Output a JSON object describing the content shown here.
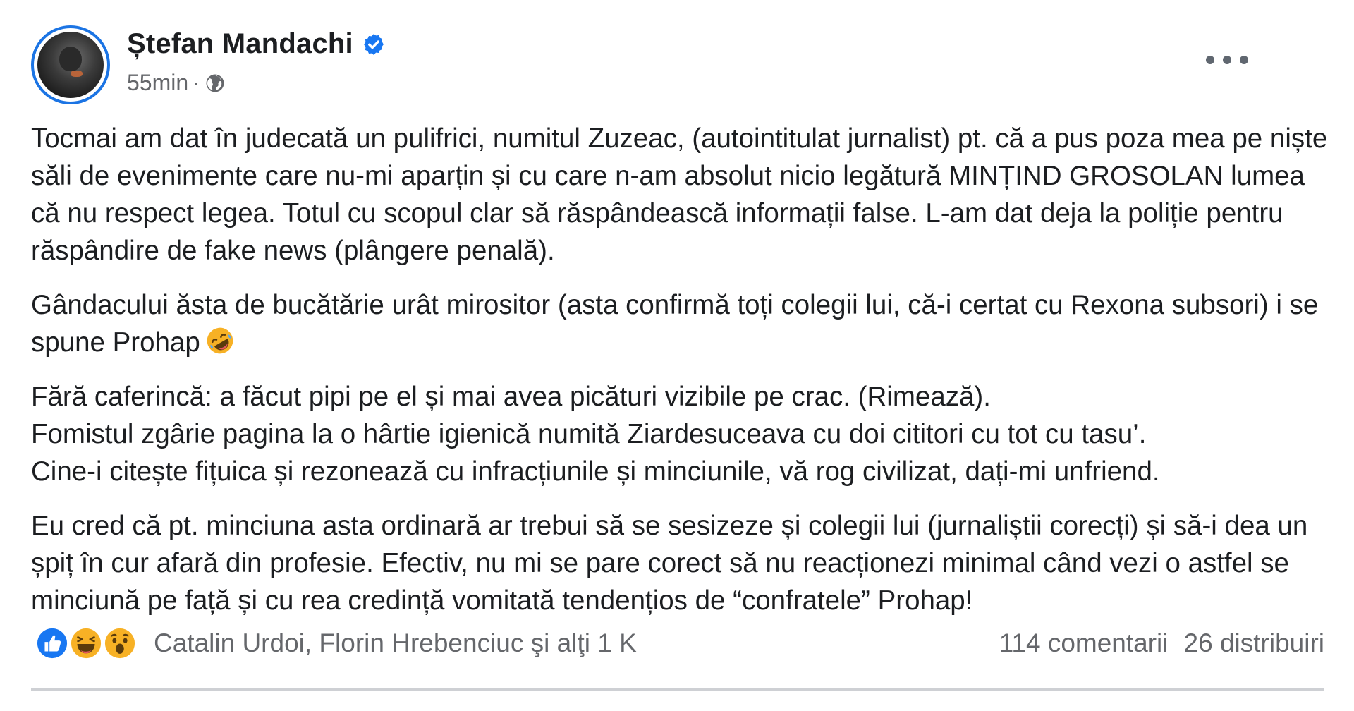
{
  "post": {
    "author": "Ștefan Mandachi",
    "timestamp": "55min",
    "separator": "·",
    "paragraphs": [
      [
        "Tocmai am dat în judecată un pulifrici, numitul Zuzeac, (autointitulat jurnalist) pt. că a pus poza mea pe niște săli de evenimente care nu-mi aparțin și cu care n-am absolut nicio legătură MINȚIND GROSOLAN lumea că nu respect legea. Totul cu scopul clar să răspândească informații false. L-am dat deja la poliție pentru răspândire de fake news (plângere penală)."
      ],
      [
        "Gândacului ăsta de bucătărie urât mirositor (asta confirmă toți colegii lui, că-i certat cu Rexona subsori) i se spune Prohap"
      ],
      [
        "Fără caferincă: a făcut pipi pe el și mai avea picături vizibile pe crac. (Rimează).",
        "Fomistul zgârie pagina la o hârtie igienică numită Ziardesuceava cu doi cititori cu tot cu tasu’.",
        "Cine-i citește fițuica și rezonează cu infracțiunile și minciunile, vă rog civilizat, dați-mi unfriend."
      ],
      [
        "Eu cred că pt. minciuna asta ordinară ar trebui să se sesizeze și colegii lui (jurnaliștii corecți) și să-i dea un șpiț în cur afară din profesie. Efectiv, nu mi se pare corect să nu reacționezi minimal când vezi o astfel se minciună pe față și cu rea credință vomitată tendențios de “confratele” Prohap!"
      ]
    ],
    "emoji_name": "rolling-on-floor-laughing",
    "reactions": [
      "like",
      "haha",
      "wow"
    ],
    "reacted_by": "Catalin Urdoi, Florin Hrebenciuc şi alţi 1 K",
    "comments": "114 comentarii",
    "shares": "26 distribuiri"
  },
  "colors": {
    "accent": "#1877f2",
    "text": "#1c1e21",
    "secondary": "#65676b",
    "haha": "#f7b125"
  }
}
